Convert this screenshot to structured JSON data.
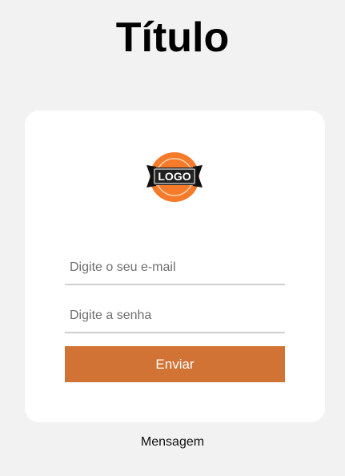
{
  "page": {
    "title": "Título",
    "message": "Mensagem"
  },
  "form": {
    "logo_text": "LOGO",
    "email_placeholder": "Digite o seu e-mail",
    "password_placeholder": "Digite a senha",
    "submit_label": "Enviar",
    "email_value": "",
    "password_value": ""
  },
  "colors": {
    "background": "#f2f2f2",
    "card": "#ffffff",
    "accent": "#d27336",
    "logo_orange": "#f57a2a",
    "logo_ribbon": "#222222"
  },
  "icons": {
    "logo": "logo-badge-icon"
  }
}
